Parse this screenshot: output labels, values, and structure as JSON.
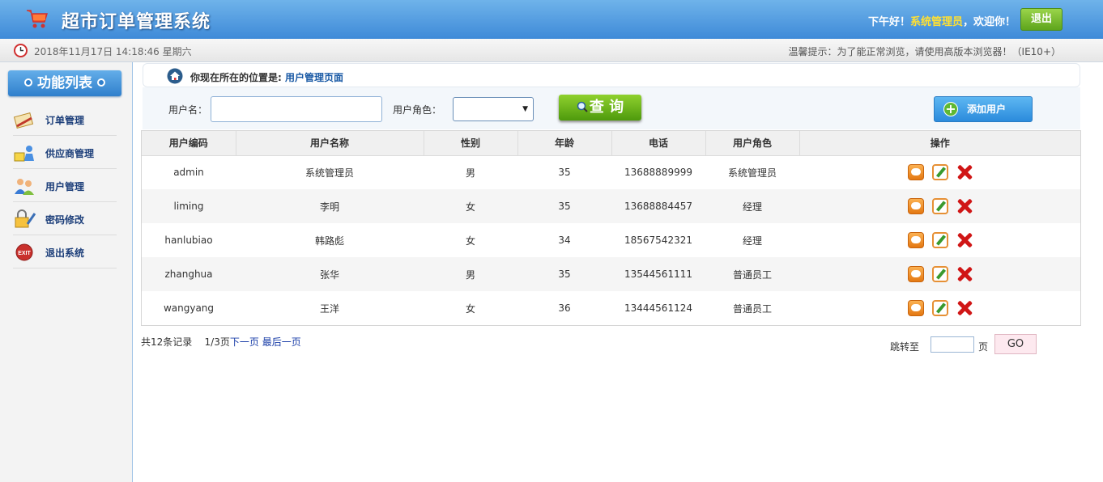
{
  "header": {
    "app_title": "超市订单管理系统",
    "greeting_prefix": "下午好！",
    "username": "系统管理员",
    "greeting_suffix": "，欢迎你！",
    "logout_label": "退出",
    "cart_icon": "shopping-cart-icon"
  },
  "infobar": {
    "datetime": "2018年11月17日 14:18:46 星期六",
    "tip": "温馨提示：为了能正常浏览，请使用高版本浏览器！（IE10+）"
  },
  "sidebar": {
    "title": "功能列表",
    "items": [
      {
        "label": "订单管理",
        "icon": "order-icon"
      },
      {
        "label": "供应商管理",
        "icon": "supplier-icon"
      },
      {
        "label": "用户管理",
        "icon": "users-icon"
      },
      {
        "label": "密码修改",
        "icon": "password-icon"
      },
      {
        "label": "退出系统",
        "icon": "exit-icon"
      }
    ]
  },
  "breadcrumb": {
    "prefix": "你现在所在的位置是:",
    "current": "用户管理页面"
  },
  "search": {
    "username_label": "用户名：",
    "username_value": "",
    "role_label": "用户角色：",
    "role_value": "",
    "query_label": "查 询",
    "add_label": "添加用户"
  },
  "table": {
    "columns": [
      "用户编码",
      "用户名称",
      "性别",
      "年龄",
      "电话",
      "用户角色",
      "操作"
    ],
    "rows": [
      [
        "admin",
        "系统管理员",
        "男",
        "35",
        "13688889999",
        "系统管理员"
      ],
      [
        "liming",
        "李明",
        "女",
        "35",
        "13688884457",
        "经理"
      ],
      [
        "hanlubiao",
        "韩路彪",
        "女",
        "34",
        "18567542321",
        "经理"
      ],
      [
        "zhanghua",
        "张华",
        "男",
        "35",
        "13544561111",
        "普通员工"
      ],
      [
        "wangyang",
        "王洋",
        "女",
        "36",
        "13444561124",
        "普通员工"
      ]
    ]
  },
  "pager": {
    "total": "共12条记录",
    "page_info": "1/3页",
    "next": "下一页",
    "last": "最后一页",
    "jump_label": "跳转至",
    "page_unit": "页",
    "go_label": "GO"
  }
}
